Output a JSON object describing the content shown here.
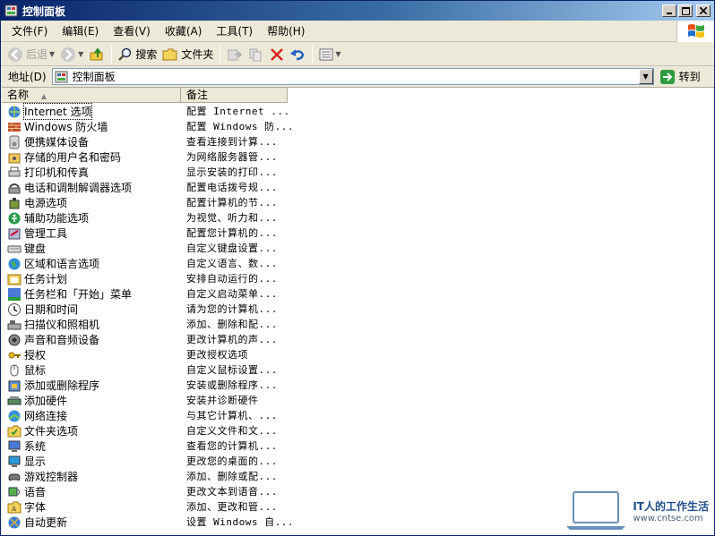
{
  "window": {
    "title": "控制面板",
    "icon": "control-panel-icon"
  },
  "menubar": {
    "items": [
      "文件(F)",
      "编辑(E)",
      "查看(V)",
      "收藏(A)",
      "工具(T)",
      "帮助(H)"
    ]
  },
  "toolbar": {
    "back_label": "后退",
    "search_label": "搜索",
    "folders_label": "文件夹"
  },
  "address": {
    "label": "地址(D)",
    "value": "控制面板",
    "go_label": "转到"
  },
  "list": {
    "columns": {
      "name": "名称",
      "note": "备注"
    },
    "rows": [
      {
        "name": "Internet 选项",
        "note": "配置 Internet ...",
        "icon": "internet-options-icon"
      },
      {
        "name": "Windows 防火墙",
        "note": "配置 Windows 防...",
        "icon": "firewall-icon"
      },
      {
        "name": "便携媒体设备",
        "note": "查看连接到计算...",
        "icon": "portable-media-icon"
      },
      {
        "name": "存储的用户名和密码",
        "note": "为网络服务器管...",
        "icon": "stored-passwords-icon"
      },
      {
        "name": "打印机和传真",
        "note": "显示安装的打印...",
        "icon": "printer-icon"
      },
      {
        "name": "电话和调制解调器选项",
        "note": "配置电话拨号规...",
        "icon": "phone-modem-icon"
      },
      {
        "name": "电源选项",
        "note": "配置计算机的节...",
        "icon": "power-icon"
      },
      {
        "name": "辅助功能选项",
        "note": "为视觉、听力和...",
        "icon": "accessibility-icon"
      },
      {
        "name": "管理工具",
        "note": "配置您计算机的...",
        "icon": "admin-tools-icon"
      },
      {
        "name": "键盘",
        "note": "自定义键盘设置...",
        "icon": "keyboard-icon"
      },
      {
        "name": "区域和语言选项",
        "note": "自定义语言、数...",
        "icon": "globe-icon"
      },
      {
        "name": "任务计划",
        "note": "安排自动运行的...",
        "icon": "scheduled-tasks-icon"
      },
      {
        "name": "任务栏和「开始」菜单",
        "note": "自定义启动菜单...",
        "icon": "taskbar-icon"
      },
      {
        "name": "日期和时间",
        "note": "请为您的计算机...",
        "icon": "clock-icon"
      },
      {
        "name": "扫描仪和照相机",
        "note": "添加、删除和配...",
        "icon": "scanner-icon"
      },
      {
        "name": "声音和音频设备",
        "note": "更改计算机的声...",
        "icon": "speaker-icon"
      },
      {
        "name": "授权",
        "note": "更改授权选项",
        "icon": "key-icon"
      },
      {
        "name": "鼠标",
        "note": "自定义鼠标设置...",
        "icon": "mouse-icon"
      },
      {
        "name": "添加或删除程序",
        "note": "安装或删除程序...",
        "icon": "add-remove-programs-icon"
      },
      {
        "name": "添加硬件",
        "note": "安装并诊断硬件",
        "icon": "add-hardware-icon"
      },
      {
        "name": "网络连接",
        "note": "与其它计算机、...",
        "icon": "network-icon"
      },
      {
        "name": "文件夹选项",
        "note": "自定义文件和文...",
        "icon": "folder-options-icon"
      },
      {
        "name": "系统",
        "note": "查看您的计算机...",
        "icon": "system-icon"
      },
      {
        "name": "显示",
        "note": "更改您的桌面的...",
        "icon": "display-icon"
      },
      {
        "name": "游戏控制器",
        "note": "添加、删除或配...",
        "icon": "game-controller-icon"
      },
      {
        "name": "语音",
        "note": "更改文本到语音...",
        "icon": "speech-icon"
      },
      {
        "name": "字体",
        "note": "添加、更改和管...",
        "icon": "fonts-icon"
      },
      {
        "name": "自动更新",
        "note": "设置 Windows 自...",
        "icon": "auto-update-icon"
      }
    ]
  },
  "watermark": {
    "title": "IT人的工作生活",
    "url": "www.cntse.com"
  }
}
